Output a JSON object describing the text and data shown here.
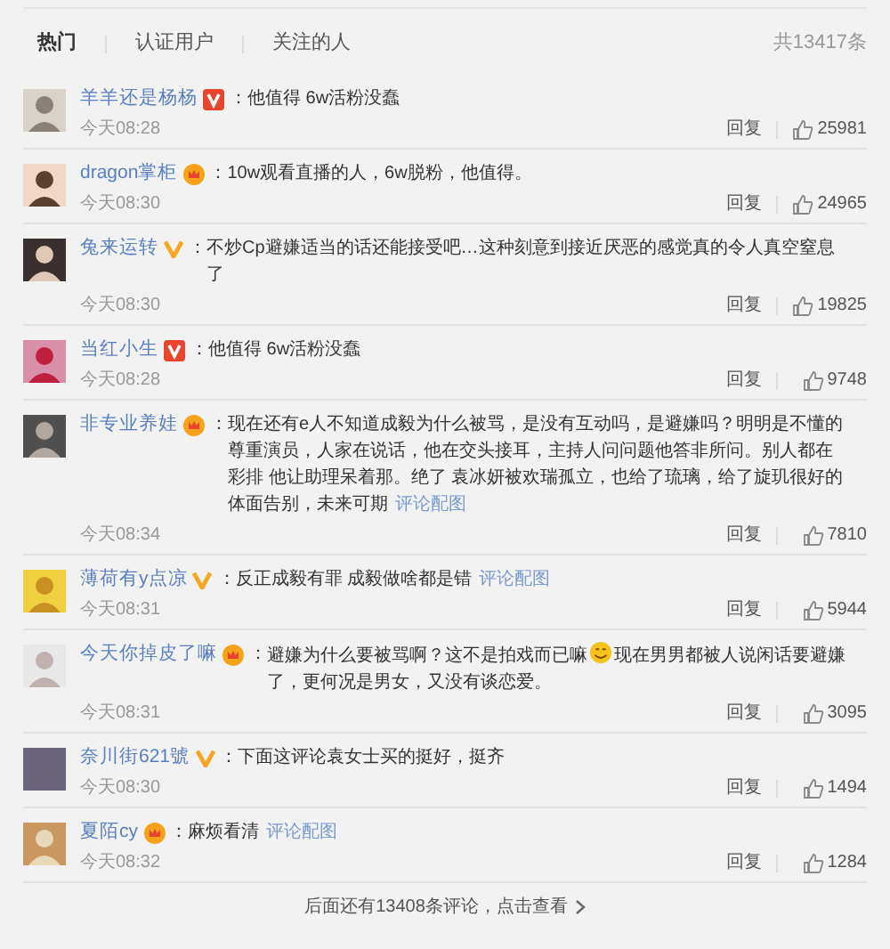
{
  "tabs": [
    {
      "label": "热门",
      "selected": true
    },
    {
      "label": "认证用户",
      "selected": false
    },
    {
      "label": "关注的人",
      "selected": false
    }
  ],
  "total": "共13417条",
  "separator": "：",
  "comments": [
    {
      "name": "羊羊还是杨杨",
      "kind": "red_v",
      "parts": [
        {
          "kind": "text",
          "text": "他值得 6w活粉没蠢"
        }
      ],
      "time": "今天08:28",
      "reply": "回复",
      "likes": "25981"
    },
    {
      "name": "dragon掌柜",
      "kind": "crown",
      "parts": [
        {
          "kind": "text",
          "text": "10w观看直播的人，6w脱粉，他值得。"
        }
      ],
      "time": "今天08:30",
      "reply": "回复",
      "likes": "24965"
    },
    {
      "name": "兔来运转",
      "kind": "yellow_v",
      "parts": [
        {
          "kind": "text",
          "text": "不炒Cp避嫌适当的话还能接受吧…这种刻意到接近厌恶的感觉真的令人真空窒息了"
        }
      ],
      "time": "今天08:30",
      "reply": "回复",
      "likes": "19825"
    },
    {
      "name": "当红小生",
      "kind": "red_v",
      "parts": [
        {
          "kind": "text",
          "text": "他值得 6w活粉没蠢"
        }
      ],
      "time": "今天08:28",
      "reply": "回复",
      "likes": "9748"
    },
    {
      "name": "非专业养娃",
      "kind": "crown",
      "parts": [
        {
          "kind": "text",
          "text": "现在还有e人不知道成毅为什么被骂，是没有互动吗，是避嫌吗？明明是不懂的尊重演员，人家在说话，他在交头接耳，主持人问问题他答非所问。别人都在彩排 他让助理呆着那。绝了 袁冰妍被欢瑞孤立，也给了琉璃，给了旋玑很好的体面告别，未来可期"
        },
        {
          "kind": "link",
          "text": "评论配图"
        }
      ],
      "time": "今天08:34",
      "reply": "回复",
      "likes": "7810"
    },
    {
      "name": "薄荷有y点凉",
      "kind": "yellow_v",
      "parts": [
        {
          "kind": "text",
          "text": "反正成毅有罪 成毅做啥都是错"
        },
        {
          "kind": "link",
          "text": "评论配图"
        }
      ],
      "time": "今天08:31",
      "reply": "回复",
      "likes": "5944"
    },
    {
      "name": "今天你掉皮了嘛",
      "kind": "crown",
      "parts": [
        {
          "kind": "text",
          "text": "避嫌为什么要被骂啊？这不是拍戏而已嘛"
        },
        {
          "kind": "emoji"
        },
        {
          "kind": "text",
          "text": "现在男男都被人说闲话要避嫌了，更何况是男女，又没有谈恋爱。"
        }
      ],
      "time": "今天08:31",
      "reply": "回复",
      "likes": "3095"
    },
    {
      "name": "奈川街621號",
      "kind": "yellow_v",
      "parts": [
        {
          "kind": "text",
          "text": "下面这评论袁女士买的挺好，挺齐"
        }
      ],
      "time": "今天08:30",
      "reply": "回复",
      "likes": "1494"
    },
    {
      "name": "夏陌cy",
      "kind": "crown",
      "parts": [
        {
          "kind": "text",
          "text": "麻烦看清"
        },
        {
          "kind": "link",
          "text": "评论配图"
        }
      ],
      "time": "今天08:32",
      "reply": "回复",
      "likes": "1284"
    }
  ],
  "more": "后面还有13408条评论，点击查看"
}
